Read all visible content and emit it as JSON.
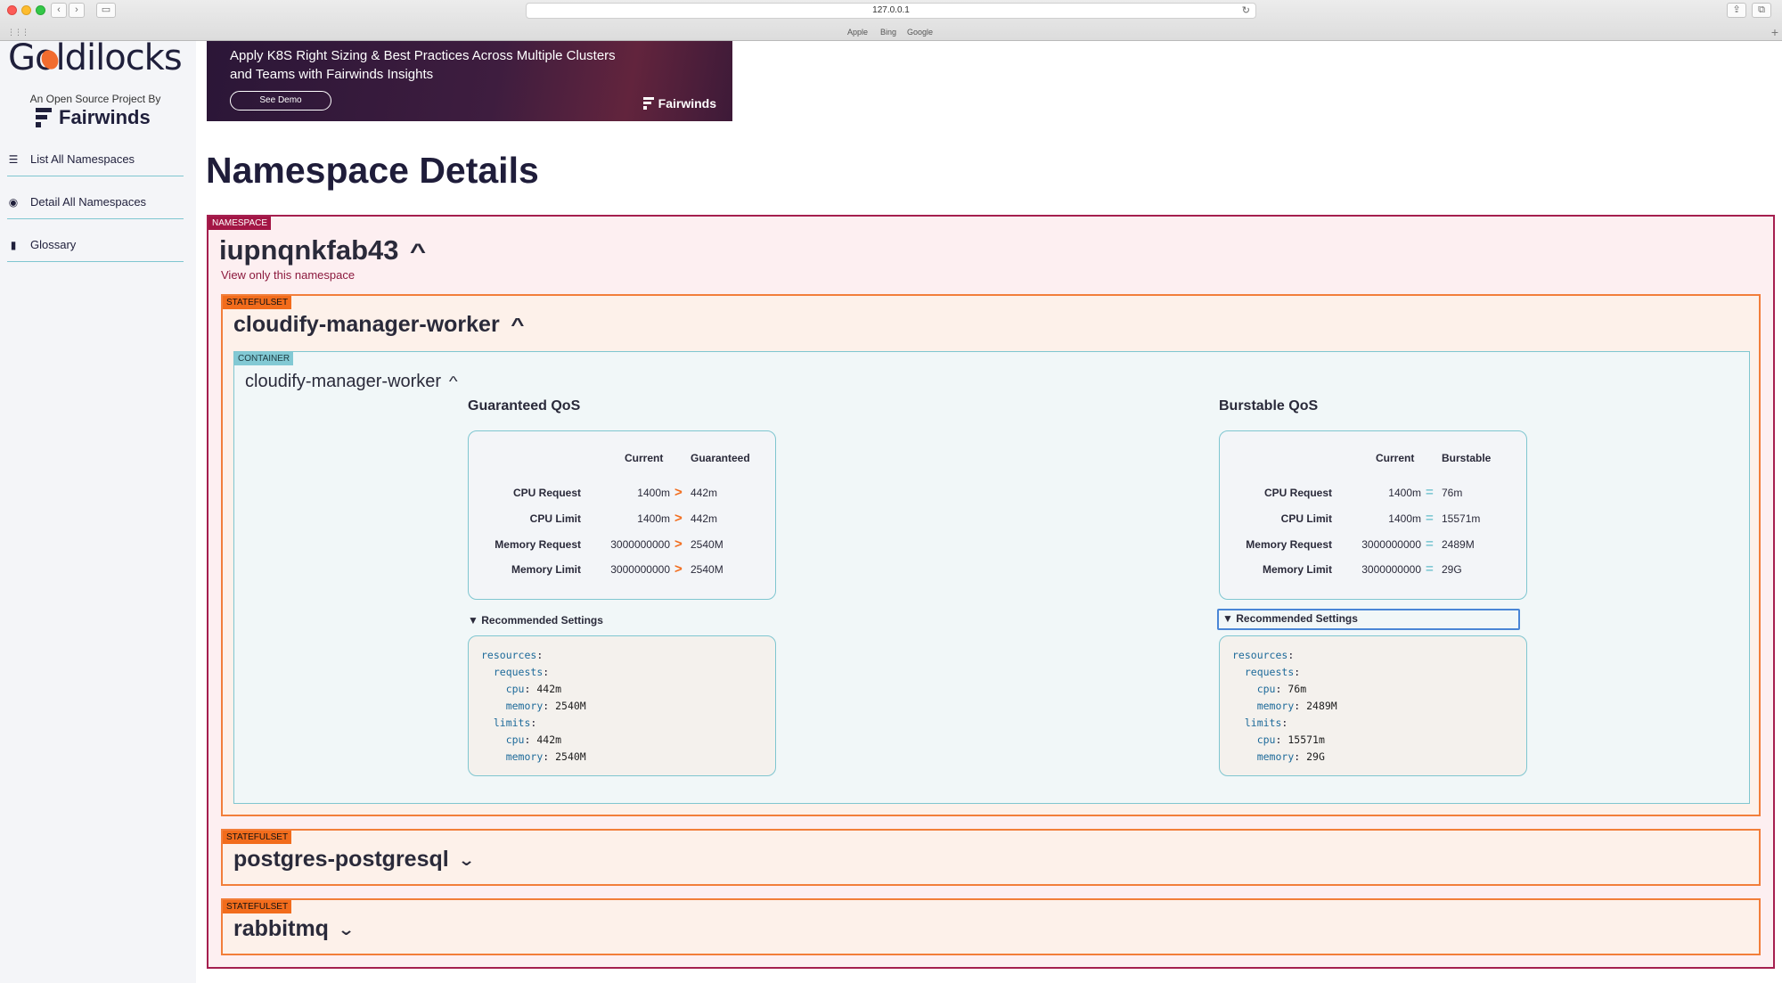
{
  "browser": {
    "url": "127.0.0.1",
    "favorites": [
      "Apple",
      "Bing",
      "Google"
    ]
  },
  "sidebar": {
    "logo": "Goldilocks",
    "byline": "An Open Source Project By",
    "brand": "Fairwinds",
    "items": [
      {
        "label": "List All Namespaces",
        "icon": "list-icon"
      },
      {
        "label": "Detail All Namespaces",
        "icon": "eye-icon"
      },
      {
        "label": "Glossary",
        "icon": "book-icon"
      }
    ]
  },
  "banner": {
    "text": "Apply K8S Right Sizing & Best Practices Across Multiple Clusters and Teams with Fairwinds Insights",
    "button": "See Demo",
    "brand": "Fairwinds"
  },
  "page_title": "Namespace Details",
  "namespace": {
    "tag": "NAMESPACE",
    "name": "iupnqnkfab43",
    "link": "View only this namespace",
    "statefulsets": [
      {
        "tag": "STATEFULSET",
        "name": "cloudify-manager-worker",
        "expanded": true
      },
      {
        "tag": "STATEFULSET",
        "name": "postgres-postgresql",
        "expanded": false
      },
      {
        "tag": "STATEFULSET",
        "name": "rabbitmq",
        "expanded": false
      }
    ]
  },
  "container": {
    "tag": "CONTAINER",
    "name": "cloudify-manager-worker",
    "guaranteed": {
      "title": "Guaranteed QoS",
      "col_current": "Current",
      "col_rec": "Guaranteed",
      "rows": [
        {
          "label": "CPU Request",
          "current": "1400m",
          "symbol": ">",
          "rec": "442m"
        },
        {
          "label": "CPU Limit",
          "current": "1400m",
          "symbol": ">",
          "rec": "442m"
        },
        {
          "label": "Memory Request",
          "current": "3000000000",
          "symbol": ">",
          "rec": "2540M"
        },
        {
          "label": "Memory Limit",
          "current": "3000000000",
          "symbol": ">",
          "rec": "2540M"
        }
      ],
      "toggle": "Recommended Settings",
      "yaml": {
        "req_cpu": "442m",
        "req_mem": "2540M",
        "lim_cpu": "442m",
        "lim_mem": "2540M"
      }
    },
    "burstable": {
      "title": "Burstable QoS",
      "col_current": "Current",
      "col_rec": "Burstable",
      "rows": [
        {
          "label": "CPU Request",
          "current": "1400m",
          "symbol": "=",
          "rec": "76m"
        },
        {
          "label": "CPU Limit",
          "current": "1400m",
          "symbol": "=",
          "rec": "15571m"
        },
        {
          "label": "Memory Request",
          "current": "3000000000",
          "symbol": "=",
          "rec": "2489M"
        },
        {
          "label": "Memory Limit",
          "current": "3000000000",
          "symbol": "=",
          "rec": "29G"
        }
      ],
      "toggle": "Recommended Settings",
      "yaml": {
        "req_cpu": "76m",
        "req_mem": "2489M",
        "lim_cpu": "15571m",
        "lim_mem": "29G"
      }
    },
    "yaml_keys": {
      "resources": "resources",
      "requests": "requests",
      "limits": "limits",
      "cpu": "cpu",
      "memory": "memory"
    }
  },
  "colors": {
    "namespace_accent": "#a51f4f",
    "statefulset_accent": "#f26c1c",
    "container_accent": "#82c9d4"
  }
}
